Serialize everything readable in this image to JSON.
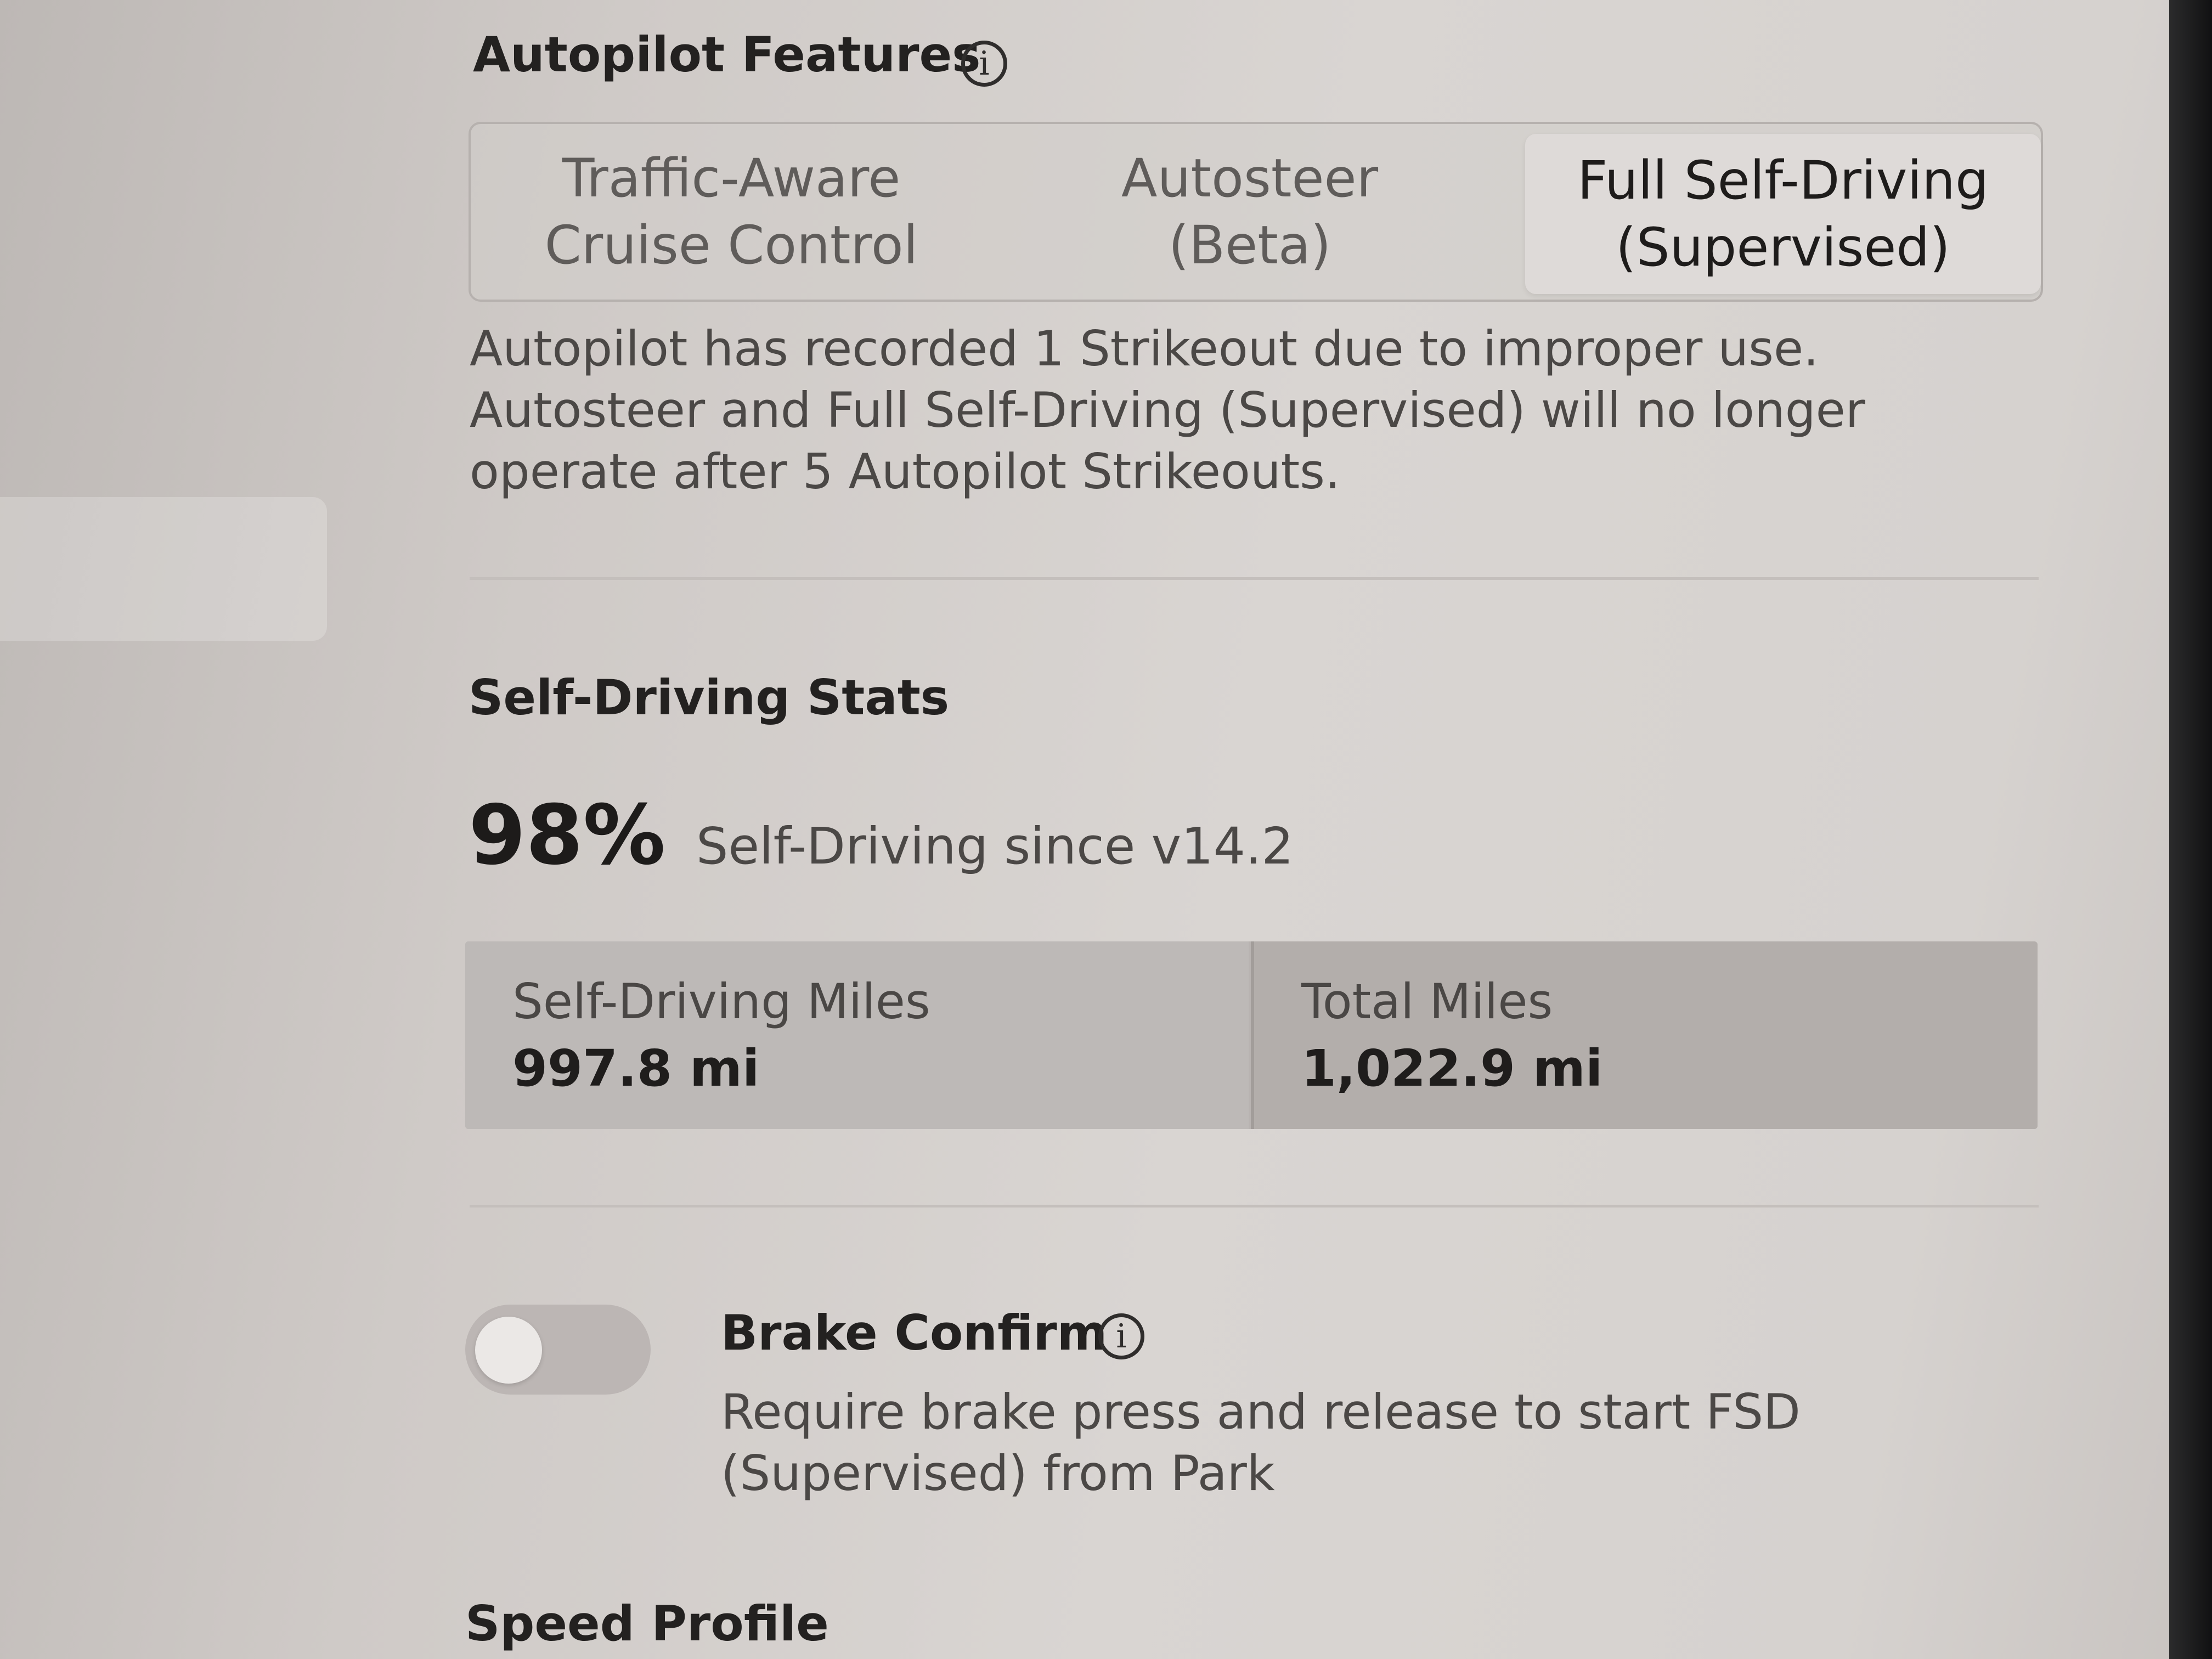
{
  "autopilot_features": {
    "title": "Autopilot Features",
    "info_icon": "info-icon",
    "options": [
      {
        "label": "Traffic-Aware\nCruise Control",
        "selected": false
      },
      {
        "label": "Autosteer\n(Beta)",
        "selected": false
      },
      {
        "label": "Full Self-Driving\n(Supervised)",
        "selected": true
      }
    ],
    "notice": "Autopilot has recorded 1 Strikeout due to improper use. Autosteer and Full Self-Driving (Supervised) will no longer operate after 5 Autopilot Strikeouts."
  },
  "self_driving_stats": {
    "title": "Self-Driving Stats",
    "percent": "98%",
    "percent_label": "Self-Driving since v14.2",
    "self_driving_miles_label": "Self-Driving Miles",
    "self_driving_miles_value": "997.8 mi",
    "total_miles_label": "Total Miles",
    "total_miles_value": "1,022.9 mi"
  },
  "brake_confirm": {
    "title": "Brake Confirm",
    "enabled": false,
    "info_icon": "info-icon",
    "description": "Require brake press and release to start FSD (Supervised) from Park"
  },
  "speed_profile": {
    "title": "Speed Profile"
  }
}
